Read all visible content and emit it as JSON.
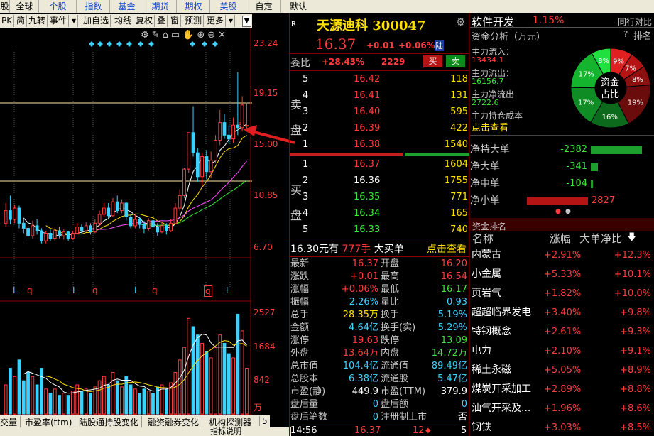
{
  "tabs": [
    "股",
    "全球",
    "个股",
    "指数",
    "基金",
    "期货",
    "期权",
    "美股",
    "自定",
    "默认"
  ],
  "toolbar": [
    "PK",
    "简",
    "九转",
    "事件",
    "▾",
    "加自选",
    "均线",
    "复权",
    "叠",
    "窗",
    "预测",
    "更多",
    "▾"
  ],
  "chart": {
    "price_axis": [
      "23.24",
      "19.15",
      "15.00",
      "10.85",
      "6.70"
    ],
    "volume_axis": [
      "2527",
      "1684",
      "842",
      "万"
    ],
    "day_markers": [
      "L",
      "q",
      "L",
      "q",
      "L",
      "q",
      "q",
      "L"
    ],
    "bottom_tabs": [
      "交量",
      "市盈率(ttm)",
      "陆股通持股变化",
      "融资融券变化",
      "机构探测器"
    ],
    "bottom_right": "指标说明",
    "tab_index": "5",
    "last_marker": "3",
    "chart_data": {
      "type": "candlestick",
      "ylim": [
        6.7,
        23.24
      ],
      "candles": [
        {
          "o": 8.6,
          "c": 9.6,
          "h": 10.2,
          "l": 8.3,
          "v": 700
        },
        {
          "o": 9.6,
          "c": 8.9,
          "h": 10.8,
          "l": 8.5,
          "v": 1100
        },
        {
          "o": 8.9,
          "c": 9.8,
          "h": 10.1,
          "l": 8.6,
          "v": 900
        },
        {
          "o": 9.8,
          "c": 8.6,
          "h": 10.0,
          "l": 8.2,
          "v": 1300
        },
        {
          "o": 8.6,
          "c": 8.2,
          "h": 9.0,
          "l": 7.8,
          "v": 800
        },
        {
          "o": 8.2,
          "c": 7.6,
          "h": 8.5,
          "l": 7.3,
          "v": 1000
        },
        {
          "o": 7.6,
          "c": 8.4,
          "h": 8.8,
          "l": 7.4,
          "v": 900
        },
        {
          "o": 8.4,
          "c": 8.0,
          "h": 8.9,
          "l": 7.7,
          "v": 700
        },
        {
          "o": 8.0,
          "c": 7.2,
          "h": 8.2,
          "l": 7.0,
          "v": 1100
        },
        {
          "o": 7.2,
          "c": 7.8,
          "h": 8.0,
          "l": 7.0,
          "v": 600
        },
        {
          "o": 7.8,
          "c": 7.4,
          "h": 8.1,
          "l": 7.2,
          "v": 500
        },
        {
          "o": 7.4,
          "c": 8.0,
          "h": 8.2,
          "l": 7.2,
          "v": 600
        },
        {
          "o": 8.0,
          "c": 7.6,
          "h": 8.3,
          "l": 7.4,
          "v": 450
        },
        {
          "o": 7.6,
          "c": 7.9,
          "h": 8.1,
          "l": 7.3,
          "v": 500
        },
        {
          "o": 7.9,
          "c": 7.4,
          "h": 8.0,
          "l": 7.2,
          "v": 450
        },
        {
          "o": 7.4,
          "c": 7.8,
          "h": 8.0,
          "l": 7.3,
          "v": 550
        },
        {
          "o": 7.8,
          "c": 8.3,
          "h": 8.6,
          "l": 7.7,
          "v": 700
        },
        {
          "o": 8.3,
          "c": 8.0,
          "h": 8.5,
          "l": 7.8,
          "v": 550
        },
        {
          "o": 8.0,
          "c": 8.4,
          "h": 8.7,
          "l": 7.9,
          "v": 600
        },
        {
          "o": 8.4,
          "c": 7.9,
          "h": 8.6,
          "l": 7.7,
          "v": 500
        },
        {
          "o": 7.9,
          "c": 8.6,
          "h": 8.9,
          "l": 7.8,
          "v": 650
        },
        {
          "o": 8.6,
          "c": 9.3,
          "h": 9.6,
          "l": 8.4,
          "v": 800
        },
        {
          "o": 9.3,
          "c": 9.8,
          "h": 10.2,
          "l": 9.1,
          "v": 900
        },
        {
          "o": 9.8,
          "c": 9.2,
          "h": 10.2,
          "l": 9.0,
          "v": 700
        },
        {
          "o": 9.2,
          "c": 10.3,
          "h": 10.6,
          "l": 9.1,
          "v": 1000
        },
        {
          "o": 10.3,
          "c": 9.6,
          "h": 10.8,
          "l": 9.4,
          "v": 800
        },
        {
          "o": 9.6,
          "c": 10.2,
          "h": 10.5,
          "l": 9.4,
          "v": 650
        },
        {
          "o": 10.2,
          "c": 9.1,
          "h": 10.3,
          "l": 8.8,
          "v": 900
        },
        {
          "o": 9.1,
          "c": 8.4,
          "h": 9.3,
          "l": 8.2,
          "v": 700
        },
        {
          "o": 8.4,
          "c": 8.9,
          "h": 9.3,
          "l": 8.2,
          "v": 600
        },
        {
          "o": 8.9,
          "c": 8.5,
          "h": 9.1,
          "l": 8.2,
          "v": 500
        },
        {
          "o": 8.5,
          "c": 8.2,
          "h": 8.8,
          "l": 7.8,
          "v": 600
        },
        {
          "o": 8.2,
          "c": 8.8,
          "h": 9.0,
          "l": 8.0,
          "v": 550
        },
        {
          "o": 8.8,
          "c": 8.3,
          "h": 9.0,
          "l": 8.1,
          "v": 500
        },
        {
          "o": 8.3,
          "c": 7.9,
          "h": 8.6,
          "l": 7.6,
          "v": 650
        },
        {
          "o": 7.9,
          "c": 8.4,
          "h": 8.7,
          "l": 7.8,
          "v": 700
        },
        {
          "o": 8.4,
          "c": 8.0,
          "h": 8.6,
          "l": 7.7,
          "v": 600
        },
        {
          "o": 8.0,
          "c": 8.6,
          "h": 8.9,
          "l": 7.9,
          "v": 750
        },
        {
          "o": 8.6,
          "c": 9.8,
          "h": 10.2,
          "l": 8.5,
          "v": 1000
        },
        {
          "o": 9.8,
          "c": 10.8,
          "h": 11.3,
          "l": 9.6,
          "v": 1300
        },
        {
          "o": 10.8,
          "c": 12.9,
          "h": 13.0,
          "l": 10.6,
          "v": 1600
        },
        {
          "o": 12.9,
          "c": 15.8,
          "h": 15.8,
          "l": 12.6,
          "v": 2300
        },
        {
          "o": 15.8,
          "c": 14.2,
          "h": 17.9,
          "l": 13.9,
          "v": 2100
        },
        {
          "o": 14.2,
          "c": 12.3,
          "h": 14.6,
          "l": 11.9,
          "v": 1900
        },
        {
          "o": 12.3,
          "c": 13.9,
          "h": 14.2,
          "l": 11.6,
          "v": 1700
        },
        {
          "o": 13.9,
          "c": 12.7,
          "h": 14.4,
          "l": 12.1,
          "v": 1500
        },
        {
          "o": 12.7,
          "c": 13.6,
          "h": 14.3,
          "l": 12.2,
          "v": 1350
        },
        {
          "o": 13.6,
          "c": 15.2,
          "h": 15.6,
          "l": 13.4,
          "v": 1600
        },
        {
          "o": 15.2,
          "c": 16.6,
          "h": 17.6,
          "l": 14.8,
          "v": 1900
        },
        {
          "o": 16.6,
          "c": 15.6,
          "h": 17.3,
          "l": 15.3,
          "v": 1700
        },
        {
          "o": 15.6,
          "c": 15.3,
          "h": 16.4,
          "l": 14.9,
          "v": 1450
        },
        {
          "o": 15.3,
          "c": 16.4,
          "h": 17.0,
          "l": 15.0,
          "v": 1350
        },
        {
          "o": 16.4,
          "c": 16.2,
          "h": 20.6,
          "l": 15.6,
          "v": 2400
        },
        {
          "o": 16.2,
          "c": 18.0,
          "h": 18.7,
          "l": 15.9,
          "v": 2000
        },
        {
          "o": 16.36,
          "c": 16.37,
          "h": 18.2,
          "l": 16.1,
          "v": 1100
        }
      ]
    }
  },
  "quote": {
    "badge": "R",
    "name_code": "天源迪科 300047",
    "price": "16.37",
    "change": "+0.01",
    "pct": "+0.06%",
    "tag": "陆",
    "weibi_label": "委比",
    "weibi": "+28.43%",
    "weicha": "2229",
    "sell_btn": "买",
    "buy_btn": "卖",
    "sell_label": [
      "卖",
      "盘"
    ],
    "buy_label": [
      "买",
      "盘"
    ],
    "asks": [
      {
        "n": "5",
        "p": "16.42",
        "v": "118"
      },
      {
        "n": "4",
        "p": "16.41",
        "v": "131"
      },
      {
        "n": "3",
        "p": "16.40",
        "v": "595"
      },
      {
        "n": "2",
        "p": "16.39",
        "v": "422"
      },
      {
        "n": "1",
        "p": "16.38",
        "v": "1540"
      }
    ],
    "bids": [
      {
        "n": "1",
        "p": "16.37",
        "v": "1604"
      },
      {
        "n": "2",
        "p": "16.36",
        "v": "1755"
      },
      {
        "n": "3",
        "p": "16.35",
        "v": "771"
      },
      {
        "n": "4",
        "p": "16.34",
        "v": "165"
      },
      {
        "n": "5",
        "p": "16.33",
        "v": "740"
      }
    ],
    "bigorder": {
      "price": "16.30元有",
      "vol": "777手",
      "label": "大买单",
      "link": "点击查看"
    },
    "stats": [
      [
        "最新",
        "16.37",
        "red",
        "开盘",
        "16.20",
        "red"
      ],
      [
        "涨跌",
        "+0.01",
        "red",
        "最高",
        "16.54",
        "red"
      ],
      [
        "涨幅",
        "+0.06%",
        "red",
        "最低",
        "16.17",
        "green"
      ],
      [
        "振幅",
        "2.26%",
        "cyan",
        "量比",
        "0.93",
        "cyan"
      ],
      [
        "总手",
        "28.35万",
        "yellow",
        "换手",
        "5.19%",
        "cyan"
      ],
      [
        "金额",
        "4.64亿",
        "cyan",
        "换手(实)",
        "5.29%",
        "cyan"
      ],
      [
        "涨停",
        "19.63",
        "red",
        "跌停",
        "13.09",
        "green"
      ],
      [
        "外盘",
        "13.64万",
        "red",
        "内盘",
        "14.72万",
        "green"
      ],
      [
        "总市值",
        "104.4亿",
        "cyan",
        "流通值",
        "89.49亿",
        "cyan"
      ],
      [
        "总股本",
        "6.38亿",
        "cyan",
        "流通股",
        "5.47亿",
        "cyan"
      ],
      [
        "市盈(静)",
        "449.9",
        "white",
        "市盈(TTM)",
        "379.9",
        "white"
      ],
      [
        "盘后量",
        "0",
        "cyan",
        "盘后额",
        "0",
        "cyan"
      ],
      [
        "盘后笔数",
        "0",
        "cyan",
        "注册制上市",
        "否",
        "white"
      ]
    ],
    "tick": {
      "time": "14:56",
      "price": "16.37",
      "vol": "12",
      "arrow": "◆",
      "extra": "5"
    }
  },
  "right": {
    "sector": "软件开发",
    "sector_pct": "1.15%",
    "sector_link": "同行对比",
    "fund_title": "资金分析（万元）",
    "help": "?",
    "rank_btn": "排名",
    "fund_rows": [
      {
        "label": "主力流入：",
        "value": "13434.1",
        "cls": "red"
      },
      {
        "label": "主力流出：",
        "value": "16156.7",
        "cls": "green"
      },
      {
        "label": "主力净流出",
        "value": "2722.6",
        "cls": "green"
      },
      {
        "label": "主力持仓成本",
        "value": "",
        "cls": "red"
      }
    ],
    "fund_link": "点击查看",
    "pie_center": [
      "资金",
      "占比"
    ],
    "pie_labels": [
      "9%",
      "7%",
      "8%",
      "17%",
      "17%",
      "16%",
      "19%",
      "8%"
    ],
    "pie_slices": [
      {
        "pct": 9,
        "color": "#e02020"
      },
      {
        "pct": 7,
        "color": "#b41414"
      },
      {
        "pct": 8,
        "color": "#8c1010"
      },
      {
        "pct": 19,
        "color": "#6a0c0c"
      },
      {
        "pct": 16,
        "color": "#0c6a1c"
      },
      {
        "pct": 17,
        "color": "#108c24"
      },
      {
        "pct": 17,
        "color": "#14b42e"
      },
      {
        "pct": 8,
        "color": "#20e040"
      }
    ],
    "net_flow": [
      {
        "label": "净特大单",
        "value": "-2382",
        "dir": "neg",
        "frac": 0.84
      },
      {
        "label": "净大单",
        "value": "-341",
        "dir": "neg",
        "frac": 0.12
      },
      {
        "label": "净中单",
        "value": "-104",
        "dir": "neg",
        "frac": 0.04
      },
      {
        "label": "净小单",
        "value": "2827",
        "dir": "pos",
        "frac": 1.0
      }
    ],
    "rank_title": "资金排名",
    "rank_headers": [
      "名称",
      "涨幅",
      "大单净比"
    ],
    "ranks": [
      {
        "name": "内蒙古",
        "pct": "+2.91%",
        "net": "+12.3%"
      },
      {
        "name": "小金属",
        "pct": "+5.33%",
        "net": "+10.1%"
      },
      {
        "name": "页岩气",
        "pct": "+1.82%",
        "net": "+10.0%"
      },
      {
        "name": "超超临界发电",
        "pct": "+3.40%",
        "net": "+9.8%"
      },
      {
        "name": "特钢概念",
        "pct": "+2.61%",
        "net": "+9.3%"
      },
      {
        "name": "电力",
        "pct": "+2.10%",
        "net": "+9.1%"
      },
      {
        "name": "稀土永磁",
        "pct": "+5.05%",
        "net": "+8.9%"
      },
      {
        "name": "煤炭开采加工",
        "pct": "+2.89%",
        "net": "+8.8%"
      },
      {
        "name": "油气开采及...",
        "pct": "+1.96%",
        "net": "+8.6%"
      },
      {
        "name": "钢铁",
        "pct": "+3.03%",
        "net": "+8.5%"
      }
    ]
  }
}
